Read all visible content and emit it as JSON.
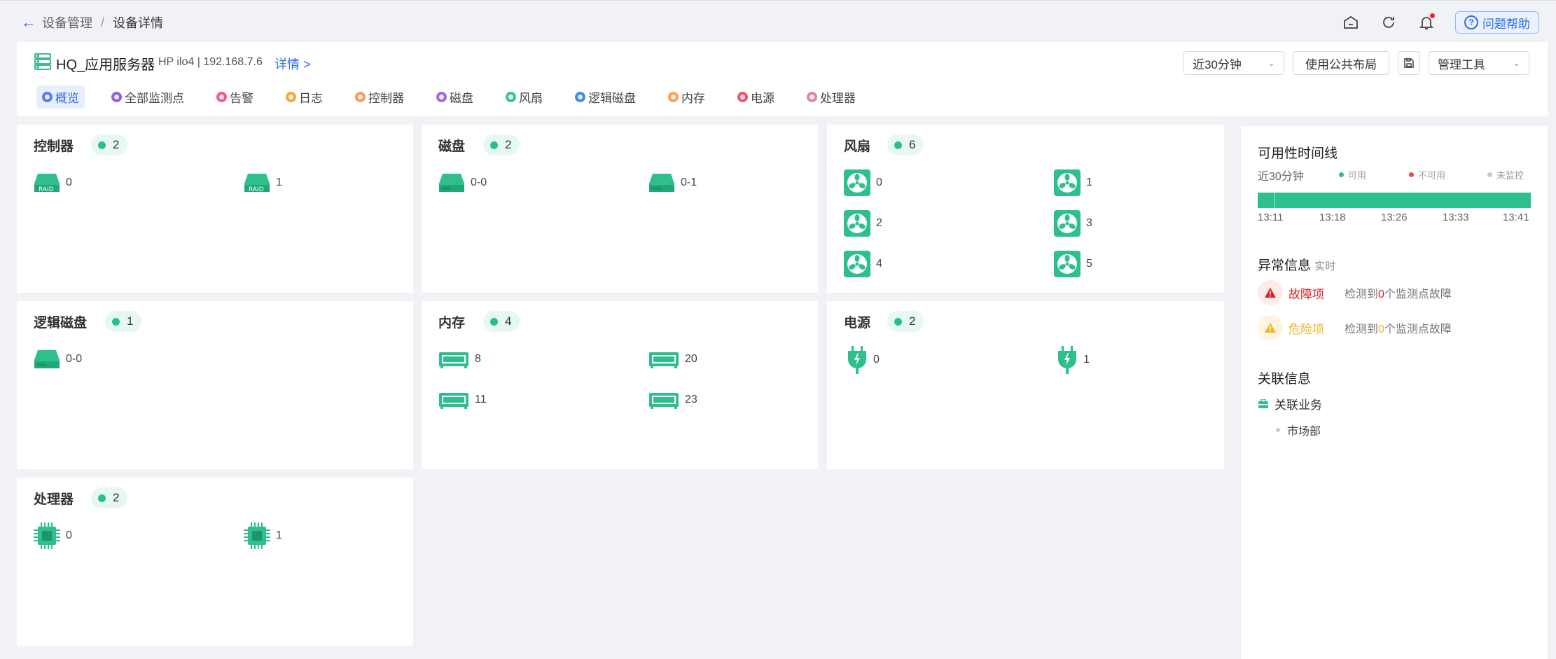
{
  "breadcrumb": {
    "parent": "设备管理",
    "separator": "/",
    "current": "设备详情"
  },
  "topbar": {
    "help_label": "问题帮助"
  },
  "device": {
    "name": "HQ_应用服务器",
    "meta": "HP ilo4 | 192.168.7.6",
    "detail_link": "详情 >"
  },
  "controls": {
    "time_range": "近30分钟",
    "layout_button": "使用公共布局",
    "tools_select": "管理工具"
  },
  "tabs": [
    {
      "label": "概览",
      "color": "#5b7cf0",
      "active": true
    },
    {
      "label": "全部监测点",
      "color": "#8e63d8",
      "active": false
    },
    {
      "label": "告警",
      "color": "#ef5b8d",
      "active": false
    },
    {
      "label": "日志",
      "color": "#f2a93b",
      "active": false
    },
    {
      "label": "控制器",
      "color": "#f59c5b",
      "active": false
    },
    {
      "label": "磁盘",
      "color": "#a46ad9",
      "active": false
    },
    {
      "label": "风扇",
      "color": "#36c1a3",
      "active": false
    },
    {
      "label": "逻辑磁盘",
      "color": "#3b8ee8",
      "active": false
    },
    {
      "label": "内存",
      "color": "#f5a35b",
      "active": false
    },
    {
      "label": "电源",
      "color": "#ef5470",
      "active": false
    },
    {
      "label": "处理器",
      "color": "#d98aa0",
      "active": false
    }
  ],
  "cards": {
    "controller": {
      "title": "控制器",
      "count": "2",
      "items": [
        "0",
        "1"
      ]
    },
    "disk": {
      "title": "磁盘",
      "count": "2",
      "items": [
        "0-0",
        "0-1"
      ]
    },
    "fan": {
      "title": "风扇",
      "count": "6",
      "items": [
        "0",
        "1",
        "2",
        "3",
        "4",
        "5"
      ]
    },
    "logical_disk": {
      "title": "逻辑磁盘",
      "count": "1",
      "items": [
        "0-0"
      ]
    },
    "memory": {
      "title": "内存",
      "count": "4",
      "items": [
        "8",
        "20",
        "11",
        "23"
      ]
    },
    "power": {
      "title": "电源",
      "count": "2",
      "items": [
        "0",
        "1"
      ]
    },
    "cpu": {
      "title": "处理器",
      "count": "2",
      "items": [
        "0",
        "1"
      ]
    }
  },
  "availability": {
    "title": "可用性时间线",
    "range": "近30分钟",
    "legend": [
      "可用",
      "不可用",
      "未监控"
    ],
    "times": [
      "13:11",
      "13:18",
      "13:26",
      "13:33",
      "13:41"
    ],
    "status": "available"
  },
  "anomalies": {
    "title": "异常信息",
    "subtitle": "实时",
    "fault": {
      "label": "故障项",
      "pre": "检测到",
      "count": "0",
      "post": "个监测点故障"
    },
    "danger": {
      "label": "危险项",
      "pre": "检测到",
      "count": "0",
      "post": "个监测点故障"
    }
  },
  "related": {
    "title": "关联信息",
    "business_label": "关联业务",
    "items": [
      "市场部"
    ]
  },
  "colors": {
    "accent": "#2f6fe4",
    "ok": "#28c08a",
    "fault": "#e02020",
    "danger": "#f0b429"
  }
}
